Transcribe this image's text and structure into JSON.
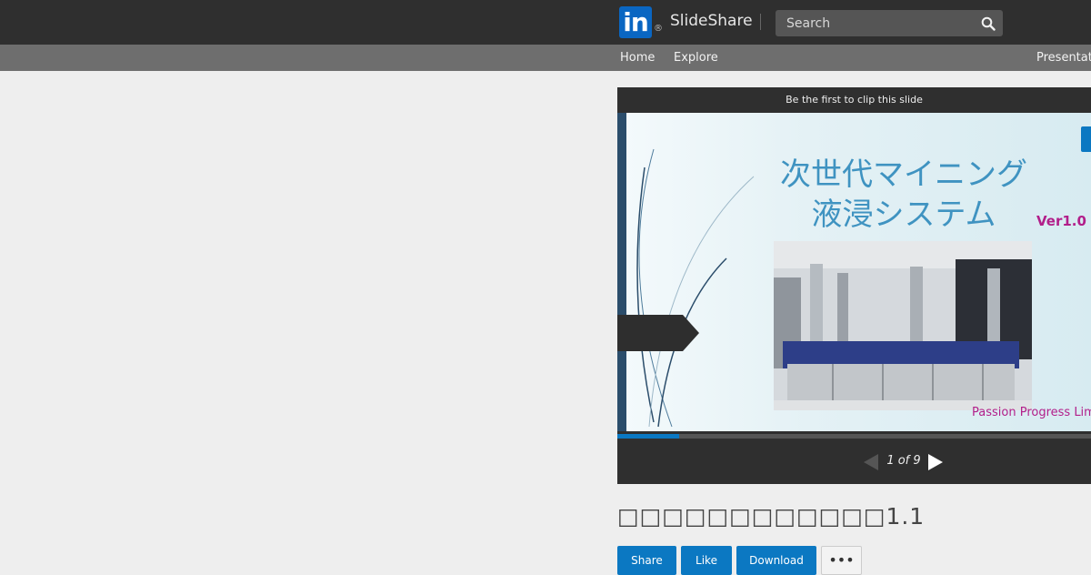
{
  "header": {
    "logo_text": "in",
    "brand": "SlideShare",
    "search_placeholder": "Search"
  },
  "nav": {
    "home": "Home",
    "explore": "Explore",
    "presentations": "Presentat"
  },
  "player": {
    "clip_text": "Be the first to clip this slide",
    "slide": {
      "title_line1": "次世代マイニング",
      "title_line2": "液浸システム",
      "version": "Ver1.0",
      "footer": "Passion Progress Lim"
    },
    "progress_fraction": 0.13,
    "page_indicator": "1 of 9"
  },
  "document": {
    "title": "□□□□□□□□□□□□1.1"
  },
  "actions": {
    "share": "Share",
    "like": "Like",
    "download": "Download",
    "more": "•••"
  },
  "colors": {
    "brand_blue": "#0b78c2",
    "topbar": "#2f2f2f",
    "navbar": "#6e6e6e",
    "accent_magenta": "#b21e8a"
  }
}
